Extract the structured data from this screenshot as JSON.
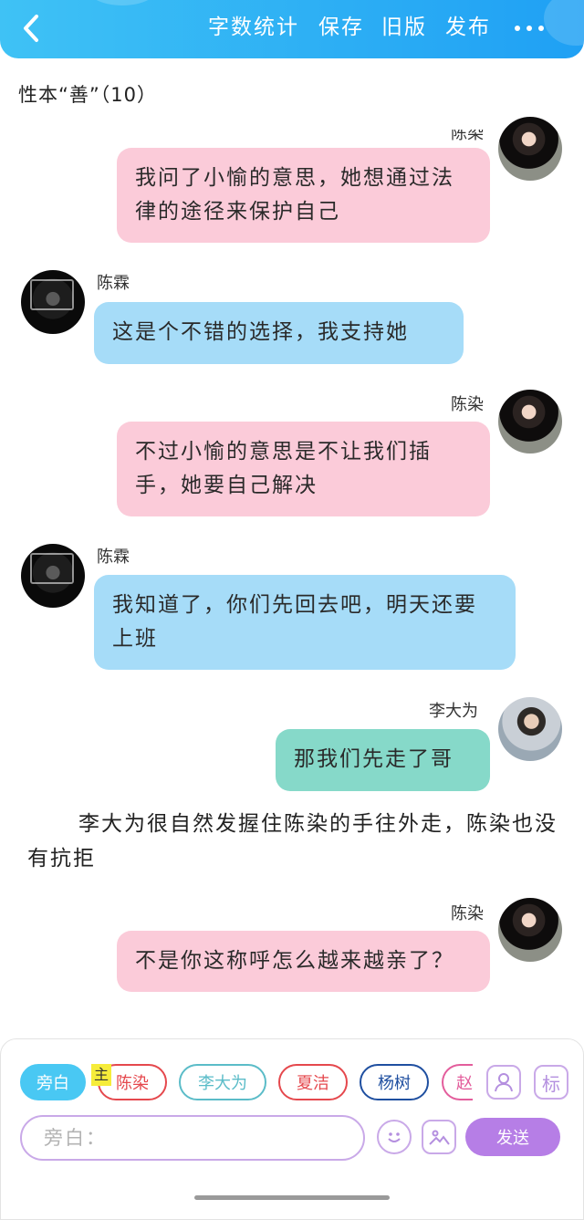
{
  "header": {
    "actions": [
      "字数统计",
      "保存",
      "旧版",
      "发布"
    ],
    "colors": {
      "gradient_start": "#3fc2f5",
      "gradient_end": "#1fa0f4"
    }
  },
  "chapter": {
    "title": "性本“善”（10）"
  },
  "messages": [
    {
      "speaker": "陈染",
      "side": "right",
      "color": "#fbcbd9",
      "text": "我问了小愉的意思，她想通过法律的途径来保护自己"
    },
    {
      "speaker": "陈霖",
      "side": "left",
      "color": "#a6dcf8",
      "text": "这是个不错的选择，我支持她"
    },
    {
      "speaker": "陈染",
      "side": "right",
      "color": "#fbcbd9",
      "text": "不过小愉的意思是不让我们插手，她要自己解决"
    },
    {
      "speaker": "陈霖",
      "side": "left",
      "color": "#a6dcf8",
      "text": "我知道了，你们先回去吧，明天还要上班"
    },
    {
      "speaker": "李大为",
      "side": "right",
      "color": "#86d9c9",
      "text": "那我们先走了哥"
    },
    {
      "speaker": "陈染",
      "side": "right",
      "color": "#fbcbd9",
      "text": "不是你这称呼怎么越来越亲了？"
    }
  ],
  "narration": "李大为很自然发握住陈染的手往外走，陈染也没有抗拒",
  "composer": {
    "host_badge": "主",
    "role_chips": [
      {
        "label": "旁白",
        "color": "#49c8f3",
        "active": true
      },
      {
        "label": "陈染",
        "color": "#e5484d"
      },
      {
        "label": "李大为",
        "color": "#5bbcc8"
      },
      {
        "label": "夏洁",
        "color": "#e5484d"
      },
      {
        "label": "杨树",
        "color": "#1f4fa0"
      },
      {
        "label": "赵",
        "color": "#e35d9c"
      }
    ],
    "tag_label": "标",
    "input_placeholder": "旁白：",
    "send_label": "发送"
  }
}
